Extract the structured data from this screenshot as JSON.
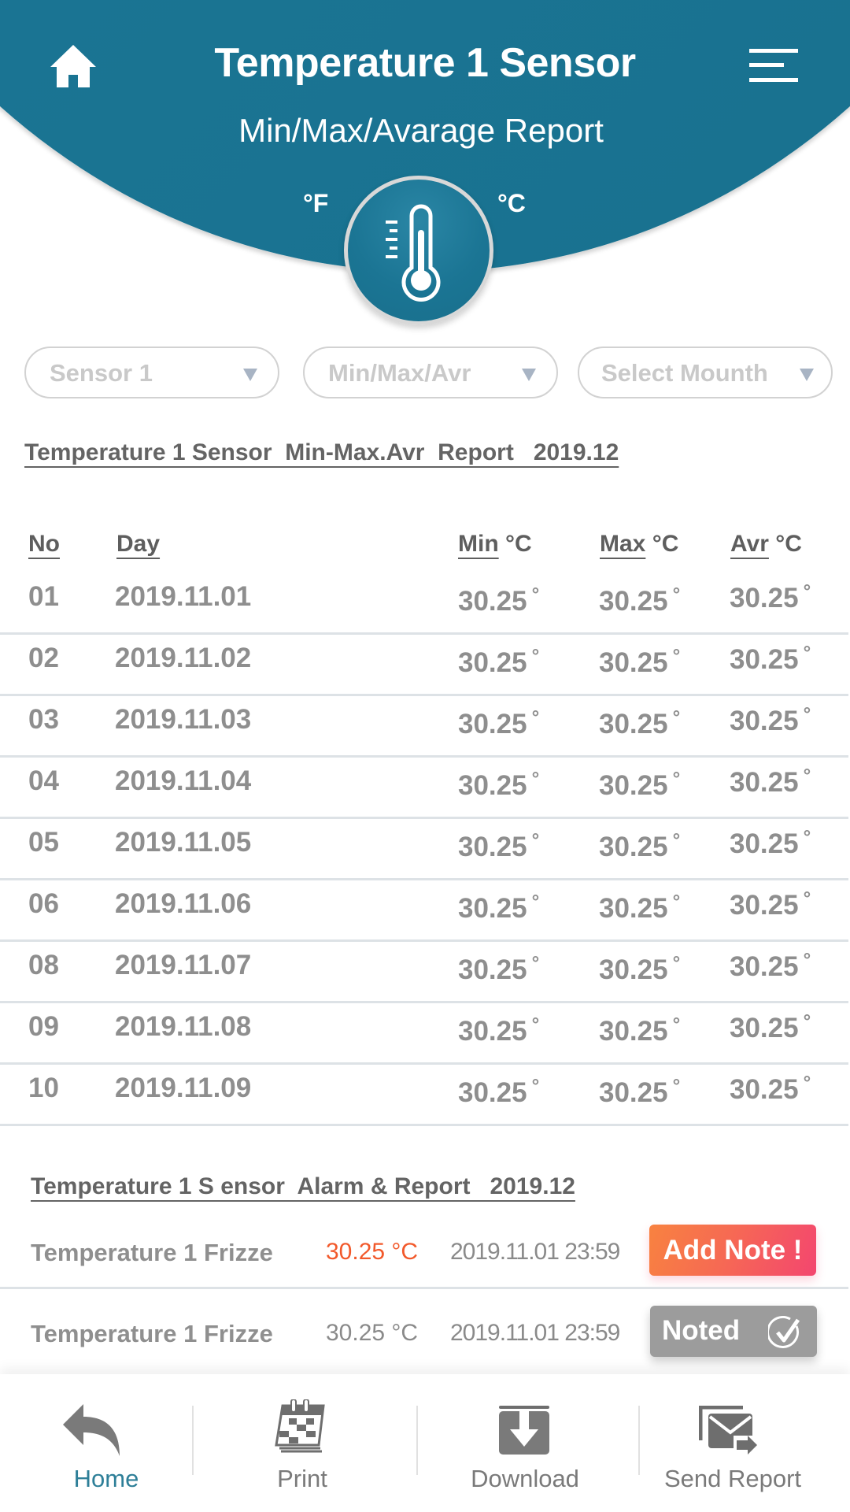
{
  "header": {
    "title": "Temperature 1 Sensor",
    "subtitle": "Min/Max/Avarage Report",
    "unit_f": "°F",
    "unit_c": "°C",
    "home_icon": "home-icon",
    "menu_icon": "hamburger-menu-icon",
    "center_icon": "thermometer-icon",
    "bg_color": "#1b7594"
  },
  "filters": [
    {
      "label": "Sensor 1"
    },
    {
      "label": "Min/Max/Avr"
    },
    {
      "label": "Select Mounth"
    }
  ],
  "report": {
    "title": "Temperature 1 Sensor  Min-Max.Avr  Report   2019.12",
    "columns": {
      "no": "No",
      "day": "Day",
      "min": "Min",
      "max": "Max",
      "avr": "Avr",
      "unit": "°C"
    },
    "degree_symbol": "°",
    "rows": [
      {
        "no": "01",
        "day": "2019.11.01",
        "min": "30.25",
        "max": "30.25",
        "avr": "30.25"
      },
      {
        "no": "02",
        "day": "2019.11.02",
        "min": "30.25",
        "max": "30.25",
        "avr": "30.25"
      },
      {
        "no": "03",
        "day": "2019.11.03",
        "min": "30.25",
        "max": "30.25",
        "avr": "30.25"
      },
      {
        "no": "04",
        "day": "2019.11.04",
        "min": "30.25",
        "max": "30.25",
        "avr": "30.25"
      },
      {
        "no": "05",
        "day": "2019.11.05",
        "min": "30.25",
        "max": "30.25",
        "avr": "30.25"
      },
      {
        "no": "06",
        "day": "2019.11.06",
        "min": "30.25",
        "max": "30.25",
        "avr": "30.25"
      },
      {
        "no": "08",
        "day": "2019.11.07",
        "min": "30.25",
        "max": "30.25",
        "avr": "30.25"
      },
      {
        "no": "09",
        "day": "2019.11.08",
        "min": "30.25",
        "max": "30.25",
        "avr": "30.25"
      },
      {
        "no": "10",
        "day": "2019.11.09",
        "min": "30.25",
        "max": "30.25",
        "avr": "30.25"
      }
    ]
  },
  "alarms": {
    "title": "Temperature 1 S ensor  Alarm & Report   2019.12",
    "items": [
      {
        "name": "Temperature 1 Frizze",
        "temp": "30.25 °C",
        "time": "2019.11.01 23:59",
        "action": "Add Note !",
        "state": "pending",
        "temp_color": "#f2592b"
      },
      {
        "name": "Temperature 1 Frizze",
        "temp": "30.25 °C",
        "time": "2019.11.01 23:59",
        "action": "Noted",
        "state": "noted",
        "icon": "check-circle-icon"
      }
    ]
  },
  "bottom_nav": [
    {
      "label": "Home",
      "icon": "back-arrow-icon",
      "active": true
    },
    {
      "label": "Print",
      "icon": "calendar-print-icon",
      "active": false
    },
    {
      "label": "Download",
      "icon": "download-icon",
      "active": false
    },
    {
      "label": "Send Report",
      "icon": "send-mail-icon",
      "active": false
    }
  ],
  "colors": {
    "brand": "#1b7594",
    "active_nav": "#2e7f98",
    "alert": "#f2592b",
    "note_gradient_start": "#f88240",
    "note_gradient_end": "#f3466f",
    "noted": "#9c9c9c"
  }
}
